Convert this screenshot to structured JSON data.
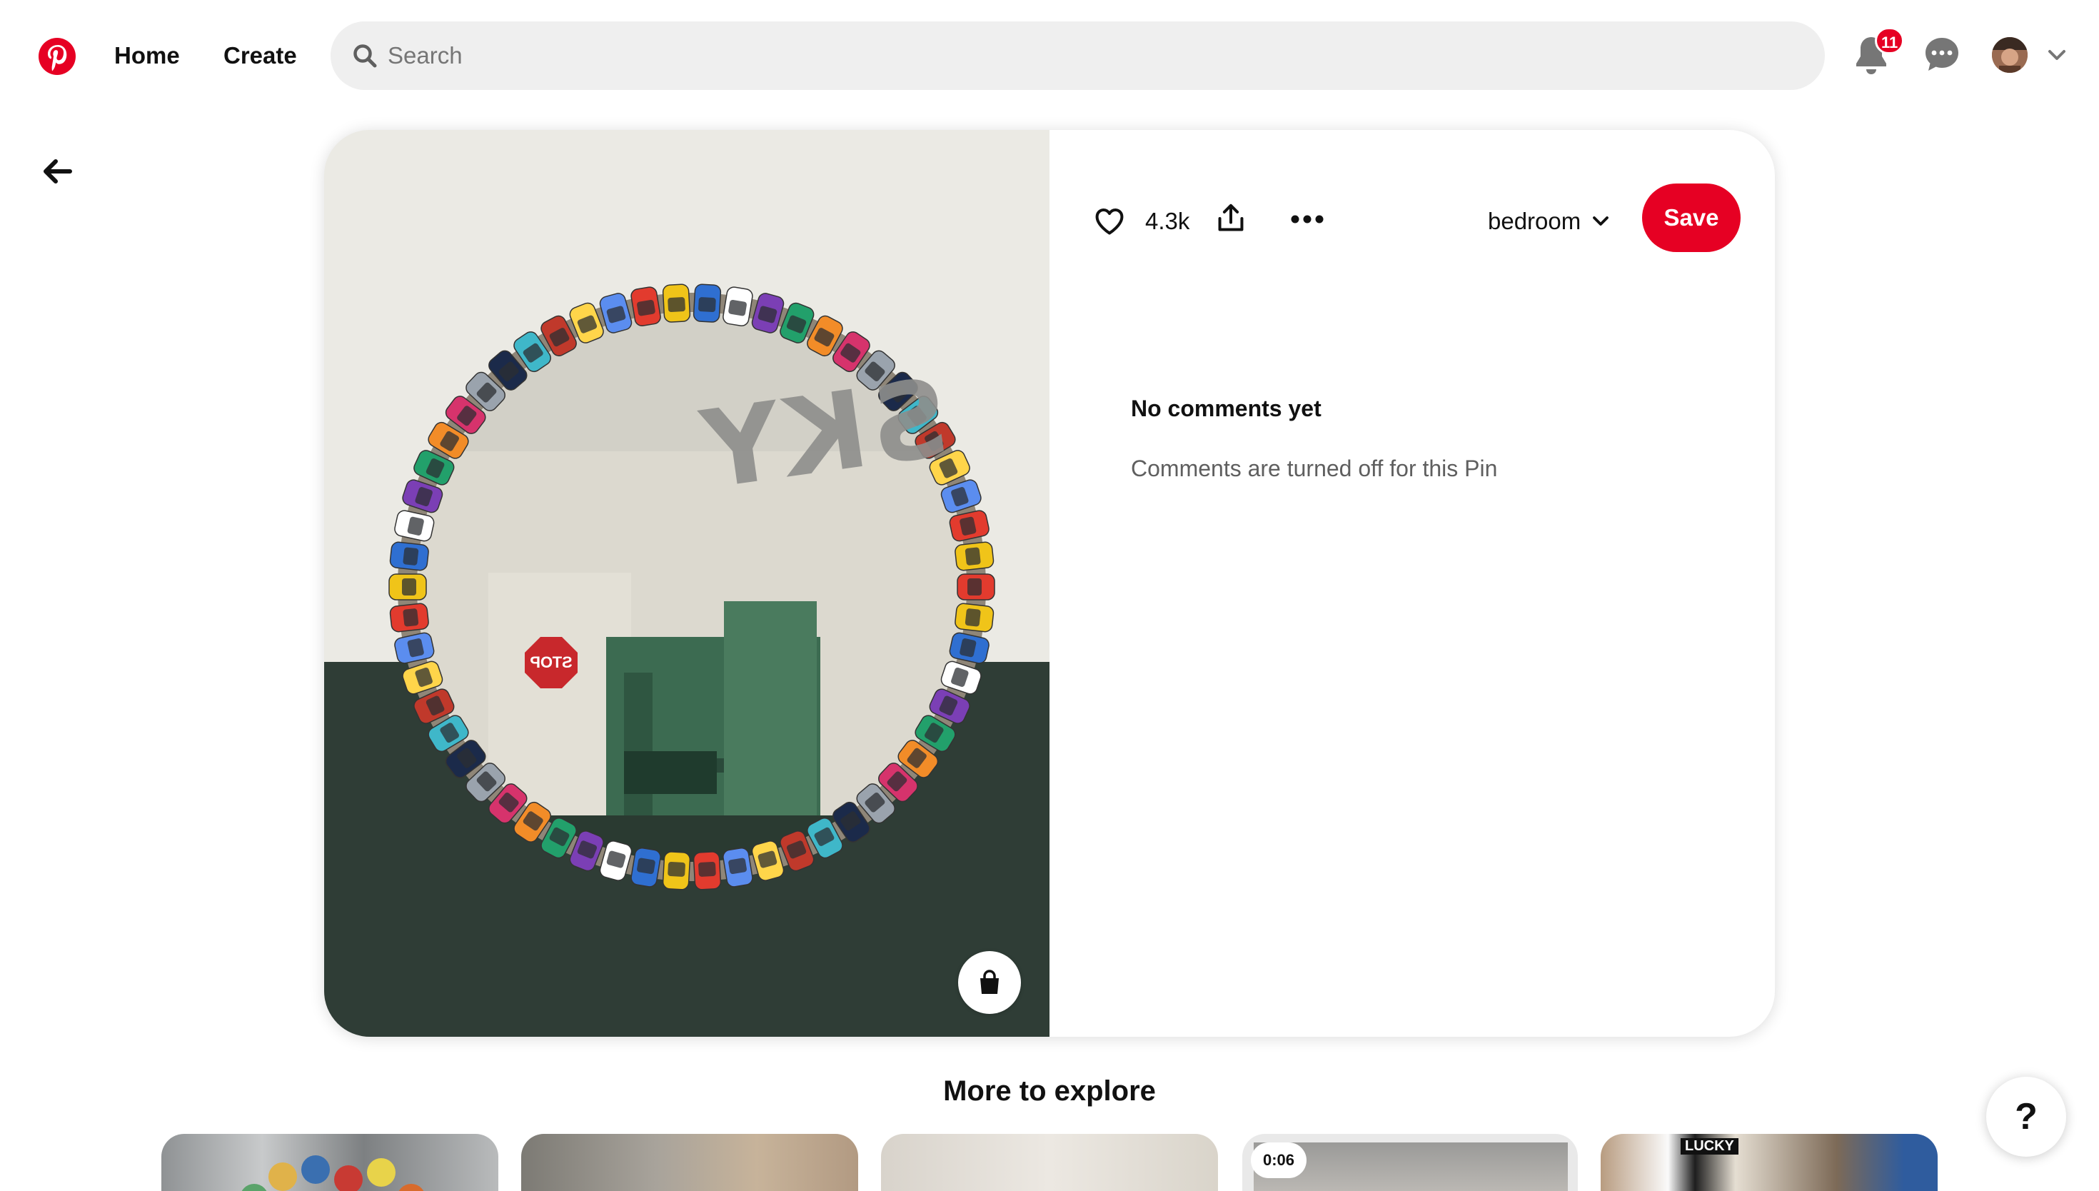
{
  "nav": {
    "logo_icon": "pinterest-logo",
    "home_label": "Home",
    "create_label": "Create",
    "search_placeholder": "Search",
    "notification_count": "11",
    "brand_color": "#e60023"
  },
  "pin": {
    "like_count": "4.3k",
    "board_name": "bedroom",
    "save_label": "Save",
    "comments_title": "No comments yet",
    "comments_note": "Comments are turned off for this Pin",
    "image_text": "SKY",
    "stop_sign_text": "STOP"
  },
  "explore": {
    "title": "More to explore",
    "video_duration": "0:06",
    "tile_text": "LUCKY"
  },
  "help_label": "?"
}
